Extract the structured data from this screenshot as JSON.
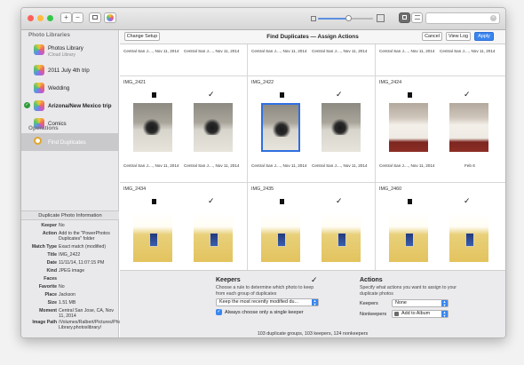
{
  "window": {
    "toolbar": {
      "add_label": "+",
      "remove_label": "−"
    },
    "colors": {
      "accent": "#3a86ef",
      "close": "#fc605b",
      "minimize": "#fdbc40",
      "zoom": "#34c84a"
    },
    "zoom_level": 0.55
  },
  "sidebar": {
    "libraries_header": "Photo Libraries",
    "libraries": [
      {
        "label": "Photos Library",
        "sub": "iCloud Library"
      },
      {
        "label": "2011 July 4th trip"
      },
      {
        "label": "Wedding"
      },
      {
        "label": "Arizona/New Mexico trip",
        "checked": true
      },
      {
        "label": "Comics"
      }
    ],
    "operations_header": "Operations",
    "operations": [
      {
        "label": "Find Duplicates",
        "icon": "magnifier-icon"
      }
    ]
  },
  "info_panel": {
    "title": "Duplicate Photo Information",
    "rows": [
      {
        "key": "Keeper",
        "value": "No"
      },
      {
        "key": "Action",
        "value": "Add to the \"PowerPhotos Duplicates\" folder"
      },
      {
        "key": "Match Type",
        "value": "Exact match (modified)"
      },
      {
        "key": "Title",
        "value": "IMG_2422"
      },
      {
        "key": "Date",
        "value": "11/11/14, 11:07:15 PM"
      },
      {
        "key": "Kind",
        "value": "JPEG image"
      },
      {
        "key": "Faces",
        "value": ""
      },
      {
        "key": "Favorite",
        "value": "No"
      },
      {
        "key": "Place",
        "value": "Jackson"
      },
      {
        "key": "Size",
        "value": "1.51 MB"
      },
      {
        "key": "Moment",
        "value": "Central San Jose, CA, Nov 11, 2014"
      },
      {
        "key": "Image Path",
        "value": "/Volumes/Ralbert/Pictures/Photos Library.photoslibrary/"
      }
    ]
  },
  "main": {
    "change_setup_label": "Change Setup",
    "title": "Find Duplicates — Assign Actions",
    "cancel_label": "Cancel",
    "view_log_label": "View Log",
    "apply_label": "Apply",
    "top_row_captions": [
      "Central San J...., Nov 11, 2014",
      "Central San J...., Nov 11, 2014",
      "Central San J...., Nov 11, 2014",
      "Central San J...., Nov 11, 2014",
      "Central San J...., Nov 11, 2014",
      "Central San J...., Nov 11, 2014"
    ],
    "groups": [
      {
        "name": "IMG_2421",
        "captions": [
          "Central San J...., Nov 11, 2014",
          "Central San J...., Nov 11, 2014"
        ]
      },
      {
        "name": "IMG_2422",
        "captions": [
          "Central San J...., Nov 11, 2014",
          "Central San J...., Nov 11, 2014"
        ]
      },
      {
        "name": "IMG_2424",
        "captions": [
          "Central San J...., Nov 11, 2014",
          "Feb 6"
        ]
      },
      {
        "name": "IMG_2434"
      },
      {
        "name": "IMG_2435"
      },
      {
        "name": "IMG_2460"
      }
    ]
  },
  "keepers": {
    "heading": "Keepers",
    "description": "Choose a rule to determine which photo to keep from each group of duplicates",
    "rule_selected": "Keep the most recently modified du...",
    "single_keeper_label": "Always choose only a single keeper",
    "single_keeper_checked": true
  },
  "actions": {
    "heading": "Actions",
    "description": "Specify what actions you want to assign to your duplicate photos",
    "keepers_label": "Keepers",
    "keepers_value": "None",
    "nonkeepers_label": "Nonkeepers",
    "nonkeepers_value": "Add to Album"
  },
  "status": "103 duplicate groups, 103 keepers, 124 nonkeepers"
}
